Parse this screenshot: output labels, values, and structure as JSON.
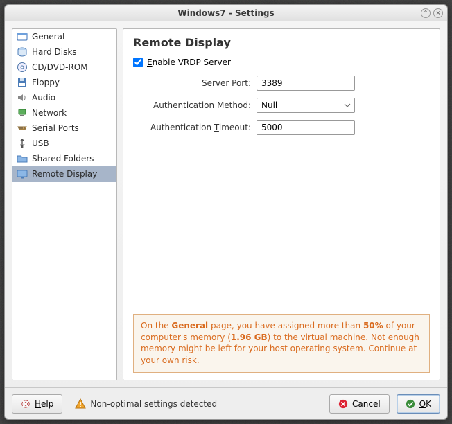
{
  "window": {
    "title": "Windows7 - Settings"
  },
  "sidebar": {
    "items": [
      {
        "label": "General",
        "icon": "general"
      },
      {
        "label": "Hard Disks",
        "icon": "harddisk"
      },
      {
        "label": "CD/DVD-ROM",
        "icon": "cd"
      },
      {
        "label": "Floppy",
        "icon": "floppy"
      },
      {
        "label": "Audio",
        "icon": "audio"
      },
      {
        "label": "Network",
        "icon": "network"
      },
      {
        "label": "Serial Ports",
        "icon": "serial"
      },
      {
        "label": "USB",
        "icon": "usb"
      },
      {
        "label": "Shared Folders",
        "icon": "folder"
      },
      {
        "label": "Remote Display",
        "icon": "display",
        "selected": true
      }
    ]
  },
  "main": {
    "heading": "Remote Display",
    "enable_vrdp": {
      "label_pre": "",
      "label": "Enable VRDP Server",
      "checked": true
    },
    "server_port": {
      "label": "Server Port:",
      "value": "3389"
    },
    "auth_method": {
      "label": "Authentication Method:",
      "value": "Null"
    },
    "auth_timeout": {
      "label": "Authentication Timeout:",
      "value": "5000"
    },
    "warning": {
      "pre": "On the ",
      "page": "General",
      "mid1": " page, you have assigned more than ",
      "pct": "50%",
      "mid2": " of your computer's memory (",
      "mem": "1.96 GB",
      "post": ") to the virtual machine. Not enough memory might be left for your host operating system. Continue at your own risk."
    }
  },
  "footer": {
    "help": "Help",
    "status": "Non-optimal settings detected",
    "cancel": "Cancel",
    "ok": "OK"
  }
}
